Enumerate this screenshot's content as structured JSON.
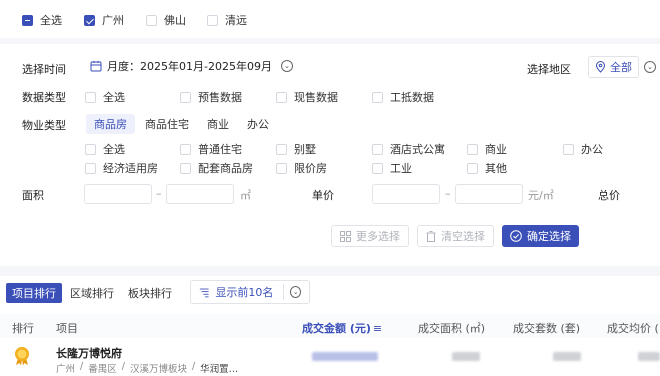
{
  "region_checks": [
    {
      "label": "全选",
      "state": "indeterminate"
    },
    {
      "label": "广州",
      "state": "checked"
    },
    {
      "label": "佛山",
      "state": "unchecked"
    },
    {
      "label": "清远",
      "state": "unchecked"
    }
  ],
  "filter": {
    "time_label": "选择时间",
    "time_value": "月度：2025年01月-2025年09月",
    "region_label": "选择地区",
    "region_value": "全部",
    "data_type_label": "数据类型",
    "data_types": [
      "全选",
      "预售数据",
      "现售数据",
      "工抵数据"
    ],
    "property_type_label": "物业类型",
    "property_tabs": [
      "商品房",
      "商品住宅",
      "商业",
      "办公"
    ],
    "property_tab_active": 0,
    "property_options_row1": [
      "全选",
      "普通住宅",
      "别墅",
      "酒店式公寓",
      "商业",
      "办公"
    ],
    "property_options_row2": [
      "经济适用房",
      "配套商品房",
      "限价房",
      "工业",
      "其他"
    ],
    "area_label": "面积",
    "area_unit": "㎡",
    "range_sep": "–",
    "unit_price_label": "单价",
    "unit_price_unit": "元/㎡",
    "total_price_label": "总价"
  },
  "actions": {
    "more": "更多选择",
    "clear": "清空选择",
    "confirm": "确定选择"
  },
  "ranking": {
    "tabs": [
      "项目排行",
      "区域排行",
      "板块排行"
    ],
    "active_tab": 0,
    "show_top": "显示前10名"
  },
  "table": {
    "headers": [
      "排行",
      "项目",
      "成交金额 (元)",
      "成交面积 (㎡)",
      "成交套数 (套)",
      "成交均价 ("
    ],
    "rows": [
      {
        "name": "长隆万博悦府",
        "path": [
          "广州",
          "番禺区",
          "汉溪万博板块",
          "华润置…"
        ]
      }
    ]
  },
  "colors": {
    "accent": "#3a4fb8",
    "medal": "#f2b01e"
  }
}
